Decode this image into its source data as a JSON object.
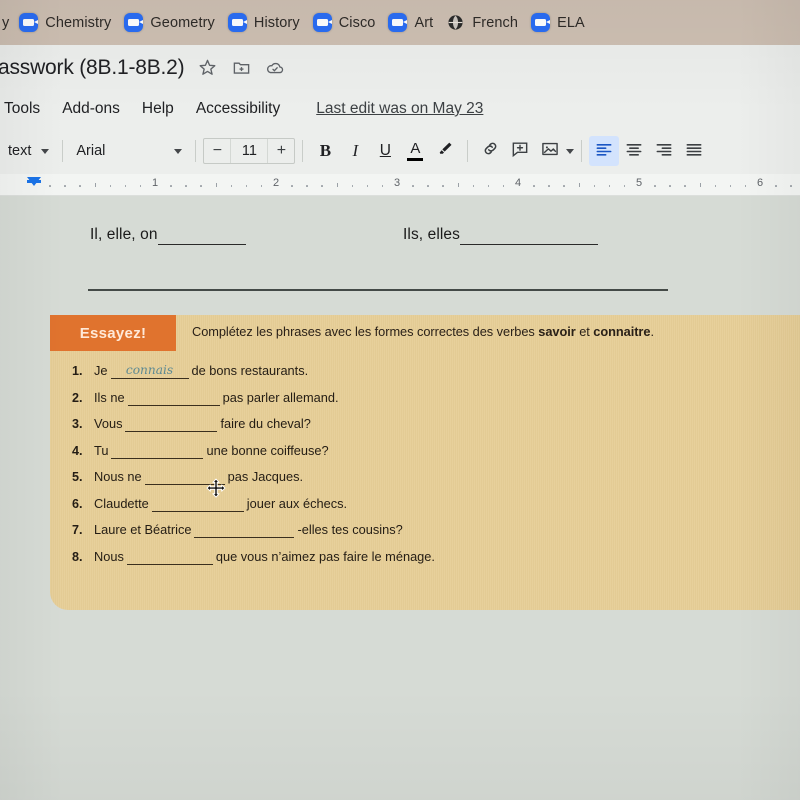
{
  "bookmarks": {
    "partial_label": "y",
    "items": [
      {
        "label": "Chemistry",
        "icon": "zoom-icon"
      },
      {
        "label": "Geometry",
        "icon": "zoom-icon"
      },
      {
        "label": "History",
        "icon": "zoom-icon"
      },
      {
        "label": "Cisco",
        "icon": "zoom-icon"
      },
      {
        "label": "Art",
        "icon": "zoom-icon"
      },
      {
        "label": "French",
        "icon": "globe-icon"
      },
      {
        "label": "ELA",
        "icon": "zoom-icon"
      }
    ]
  },
  "titlebar": {
    "doc_title": "asswork (8B.1-8B.2)",
    "star_icon": "star-icon",
    "move_folder_icon": "move-to-folder-icon",
    "cloud_icon": "cloud-saved-icon"
  },
  "menubar": {
    "items": [
      "Tools",
      "Add-ons",
      "Help",
      "Accessibility"
    ],
    "last_edit": "Last edit was on May 23"
  },
  "toolbar": {
    "style_select": "text",
    "font_select": "Arial",
    "font_size": "11",
    "decrease_label": "−",
    "increase_label": "+",
    "bold_label": "B",
    "italic_label": "I",
    "underline_label": "U",
    "text_color_label": "A",
    "highlight_icon": "highlighter-icon",
    "link_icon": "insert-link-icon",
    "comment_icon": "add-comment-icon",
    "image_icon": "insert-image-icon",
    "align_left_icon": "align-left-icon",
    "align_center_icon": "align-center-icon",
    "align_right_icon": "align-right-icon",
    "align_justify_icon": "align-justify-icon",
    "accent_color": "#d3e3fd"
  },
  "ruler": {
    "numbers": [
      "1",
      "2",
      "3",
      "4",
      "5",
      "6"
    ],
    "indent_marker_color": "#1a73e8"
  },
  "document": {
    "line1_left": "Il, elle, on",
    "line1_right": "Ils, elles",
    "worksheet": {
      "badge": "Essayez!",
      "instruction_prefix": "Complétez les phrases avec les formes correctes des verbes ",
      "instruction_bold1": "savoir",
      "instruction_mid": " et ",
      "instruction_bold2": "connaitre",
      "instruction_suffix": ".",
      "badge_color": "#e0732e",
      "sheet_color": "#e6cd96",
      "questions": [
        {
          "num": "1.",
          "before": "Je",
          "answer": "connais",
          "after": "de bons restaurants."
        },
        {
          "num": "2.",
          "before": "Ils ne",
          "answer": "",
          "after": "pas parler allemand."
        },
        {
          "num": "3.",
          "before": "Vous",
          "answer": "",
          "after": "faire du cheval?"
        },
        {
          "num": "4.",
          "before": "Tu",
          "answer": "",
          "after": "une bonne coiffeuse?"
        },
        {
          "num": "5.",
          "before": "Nous ne",
          "answer": "",
          "after": "pas Jacques."
        },
        {
          "num": "6.",
          "before": "Claudette",
          "answer": "",
          "after": "jouer aux échecs."
        },
        {
          "num": "7.",
          "before": "Laure et Béatrice",
          "answer": "",
          "after": "-elles tes cousins?"
        },
        {
          "num": "8.",
          "before": "Nous",
          "answer": "",
          "after": "que vous n’aimez pas faire le ménage."
        }
      ]
    }
  },
  "cursor": {
    "icon": "move-cursor-icon"
  }
}
